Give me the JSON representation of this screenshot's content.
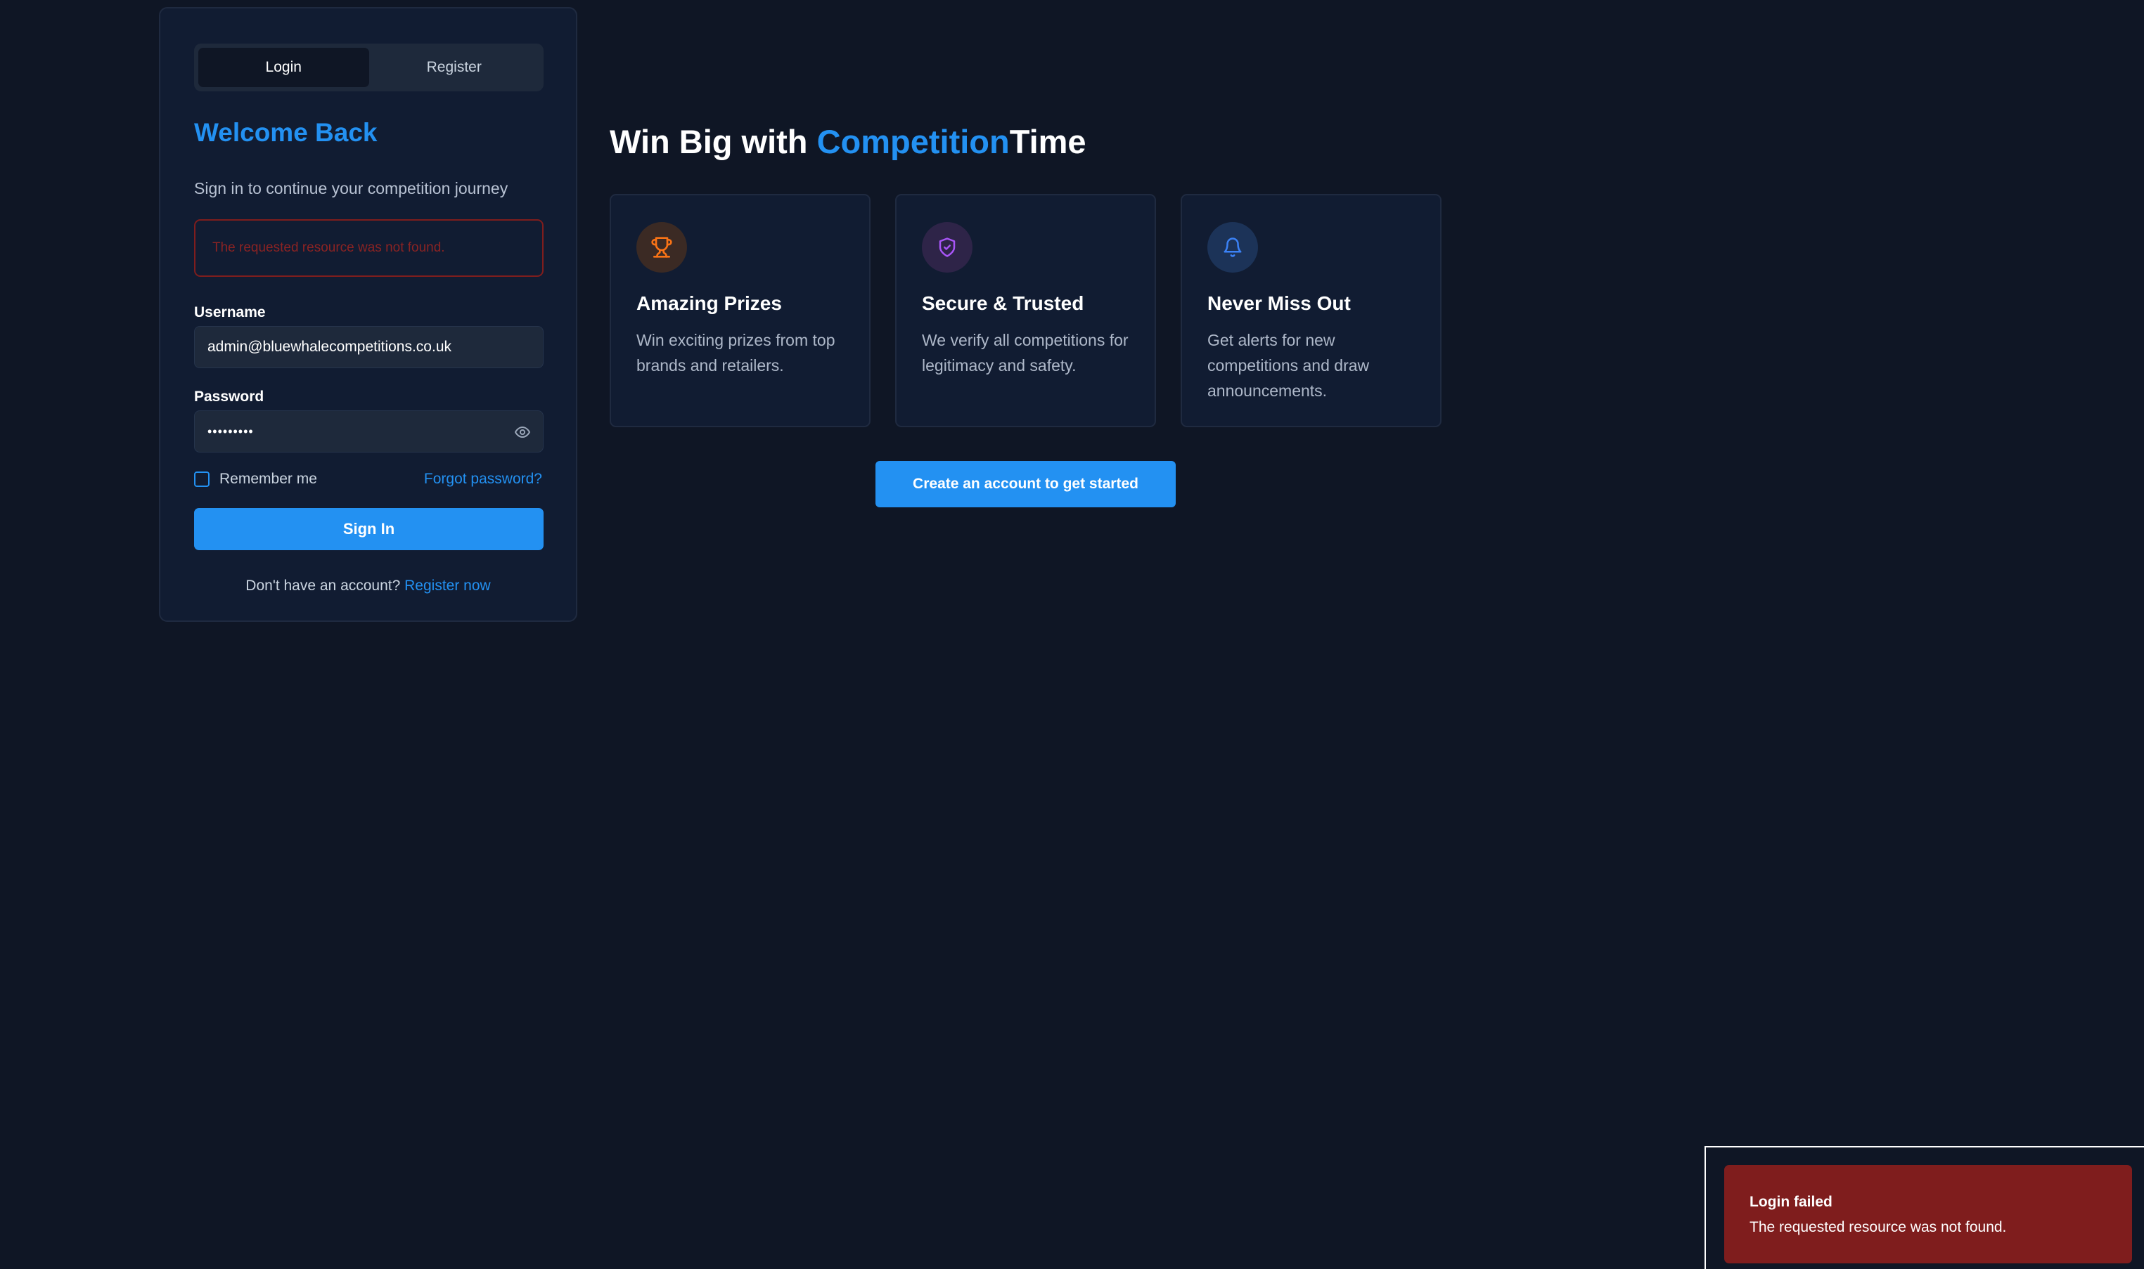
{
  "auth": {
    "tabs": [
      {
        "label": "Login",
        "active": true
      },
      {
        "label": "Register",
        "active": false
      }
    ],
    "title": "Welcome Back",
    "subtitle": "Sign in to continue your competition journey",
    "error_message": "The requested resource was not found.",
    "username_label": "Username",
    "username_value": "admin@bluewhalecompetitions.co.uk",
    "password_label": "Password",
    "password_value": "•••••••••",
    "remember_label": "Remember me",
    "remember_checked": false,
    "forgot_label": "Forgot password?",
    "signin_label": "Sign In",
    "no_account_text": "Don't have an account?",
    "register_link": "Register now"
  },
  "hero": {
    "title_prefix": "Win Big with ",
    "title_accent": "Competition",
    "title_suffix": "Time",
    "features": [
      {
        "icon": "trophy-icon",
        "title": "Amazing Prizes",
        "description": "Win exciting prizes from top brands and retailers."
      },
      {
        "icon": "shield-check-icon",
        "title": "Secure & Trusted",
        "description": "We verify all competitions for legitimacy and safety."
      },
      {
        "icon": "bell-icon",
        "title": "Never Miss Out",
        "description": "Get alerts for new competitions and draw announcements."
      }
    ],
    "cta_label": "Create an account to get started"
  },
  "toast": {
    "title": "Login failed",
    "message": "The requested resource was not found."
  },
  "colors": {
    "background": "#0f1625",
    "card": "#111c32",
    "accent": "#2391f2",
    "error": "#7f1d1d",
    "prize_icon": "#f97316",
    "secure_icon": "#a855f7",
    "alert_icon": "#3b82f6"
  }
}
